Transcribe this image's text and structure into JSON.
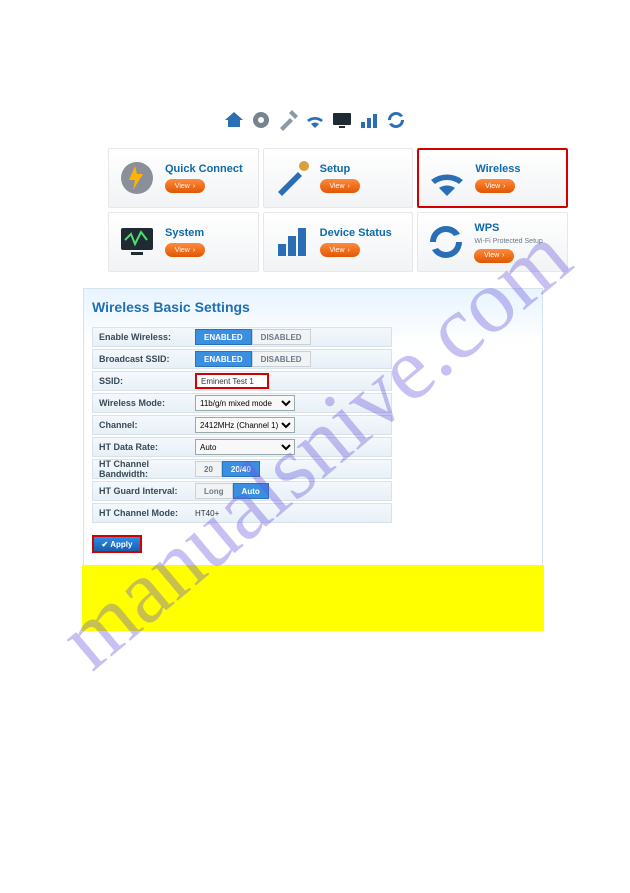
{
  "watermark": "manualsnive.com",
  "topIcons": [
    "home-icon",
    "gear-icon",
    "tools-icon",
    "wifi-icon",
    "monitor-icon",
    "bars-icon",
    "sync-icon"
  ],
  "nav": [
    {
      "title": "Quick Connect",
      "view": "View",
      "iconColor": "#8a8f99",
      "bolt": true,
      "highlight": false
    },
    {
      "title": "Setup",
      "view": "View",
      "iconColor": "#2a6fb5",
      "tool": true,
      "highlight": false
    },
    {
      "title": "Wireless",
      "view": "View",
      "iconColor": "#2a6fb5",
      "wifi": true,
      "highlight": true
    },
    {
      "title": "System",
      "view": "View",
      "iconColor": "#2a2f35",
      "monitor": true,
      "highlight": false
    },
    {
      "title": "Device Status",
      "view": "View",
      "iconColor": "#2a6fb5",
      "bars": true,
      "highlight": false
    },
    {
      "title": "WPS",
      "sub": "Wi-Fi Protected Setup",
      "view": "View",
      "iconColor": "#2a6fb5",
      "sync": true,
      "highlight": false
    }
  ],
  "panel": {
    "title": "Wireless Basic Settings",
    "rows": {
      "enableWireless": {
        "label": "Enable Wireless:",
        "enabled": "ENABLED",
        "disabled": "DISABLED"
      },
      "broadcastSsid": {
        "label": "Broadcast SSID:",
        "enabled": "ENABLED",
        "disabled": "DISABLED"
      },
      "ssid": {
        "label": "SSID:",
        "value": "Eminent Test 1"
      },
      "wirelessMode": {
        "label": "Wireless Mode:",
        "value": "11b/g/n mixed mode"
      },
      "channel": {
        "label": "Channel:",
        "value": "2412MHz (Channel 1)"
      },
      "htDataRate": {
        "label": "HT Data Rate:",
        "value": "Auto"
      },
      "htBandwidth": {
        "label": "HT Channel Bandwidth:",
        "opt1": "20",
        "opt2": "20/40"
      },
      "htGuard": {
        "label": "HT Guard Interval:",
        "opt1": "Long",
        "opt2": "Auto"
      },
      "htChannelMode": {
        "label": "HT Channel Mode:",
        "value": "HT40+"
      }
    },
    "apply": "Apply"
  }
}
